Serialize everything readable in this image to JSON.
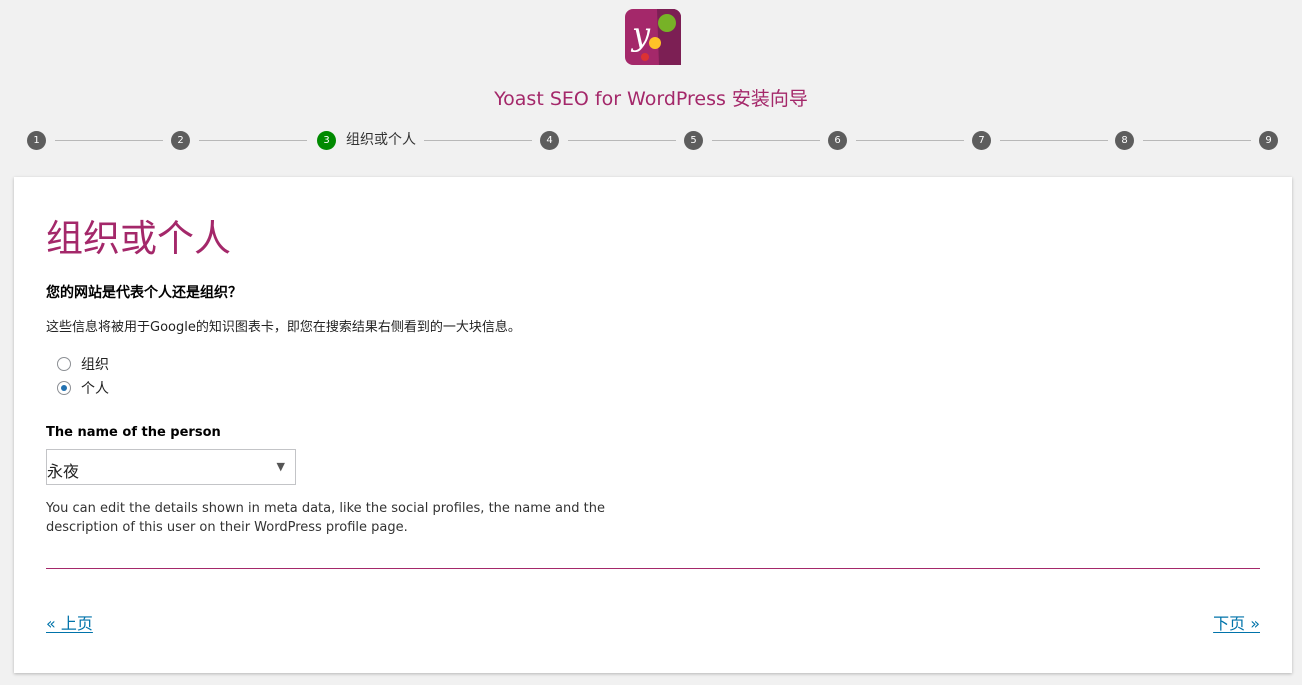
{
  "header": {
    "title": "Yoast SEO for WordPress 安装向导",
    "logo_icon": "yoast-logo-icon",
    "brand_color": "#a4286a",
    "active_color": "#008a00"
  },
  "stepper": {
    "steps": [
      {
        "number": "1"
      },
      {
        "number": "2"
      },
      {
        "number": "3",
        "label": "组织或个人",
        "active": true
      },
      {
        "number": "4"
      },
      {
        "number": "5"
      },
      {
        "number": "6"
      },
      {
        "number": "7"
      },
      {
        "number": "8"
      },
      {
        "number": "9"
      }
    ]
  },
  "main": {
    "title": "组织或个人",
    "question": "您的网站是代表个人还是组织？",
    "description": "这些信息将被用于Google的知识图表卡，即您在搜索结果右侧看到的一大块信息。",
    "options": [
      {
        "label": "组织",
        "checked": false
      },
      {
        "label": "个人",
        "checked": true
      }
    ],
    "person_field_label": "The name of the person",
    "person_select_value": "永夜",
    "help_text": "You can edit the details shown in meta data, like the social profiles, the name and the description of this user on their WordPress profile page.",
    "prev_label": "« 上页",
    "next_label": "下页 »"
  }
}
